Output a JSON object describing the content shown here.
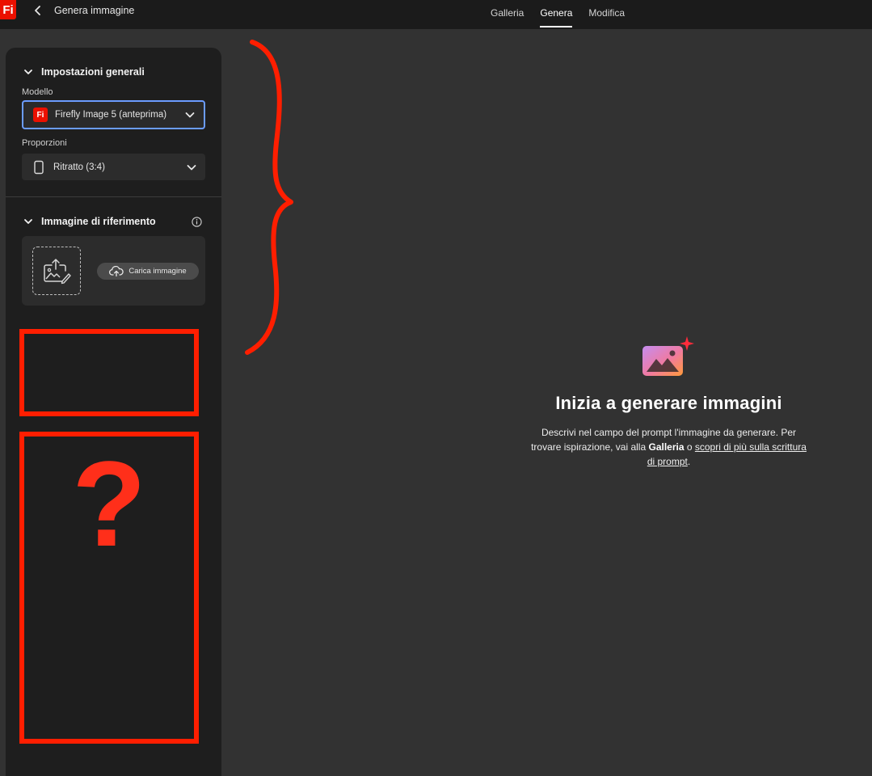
{
  "app": {
    "logo_text": "Fi",
    "page_title": "Genera immagine",
    "brand_color": "#eb1000"
  },
  "header": {
    "tabs": [
      {
        "label": "Galleria",
        "active": false
      },
      {
        "label": "Genera",
        "active": true
      },
      {
        "label": "Modifica",
        "active": false
      }
    ]
  },
  "sidebar": {
    "general": {
      "title": "Impostazioni generali",
      "model_label": "Modello",
      "model_badge": "Fi",
      "model_value": "Firefly Image 5 (anteprima)",
      "ratio_label": "Proporzioni",
      "ratio_value": "Ritratto (3:4)"
    },
    "reference": {
      "title": "Immagine di riferimento",
      "upload_label": "Carica immagine"
    }
  },
  "annotation": {
    "question_mark": "?",
    "color": "#ff1e00"
  },
  "empty_state": {
    "title": "Inizia a generare immagini",
    "desc_1": "Descrivi nel campo del prompt l'immagine da generare. Per trovare ispirazione, vai alla ",
    "desc_gallery": "Galleria",
    "desc_2": " o ",
    "desc_link": "scopri di più sulla scrittura di prompt",
    "desc_3": "."
  }
}
